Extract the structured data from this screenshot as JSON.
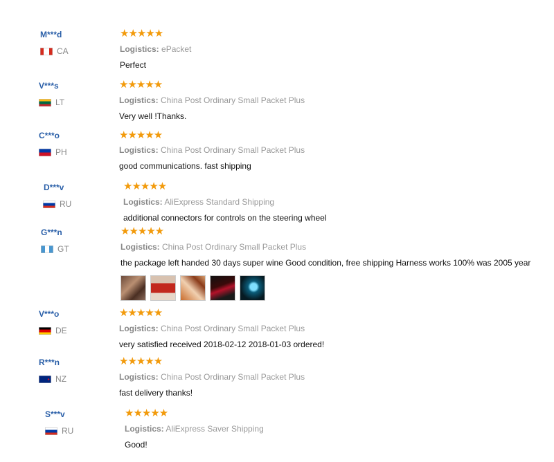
{
  "reviews": [
    {
      "user": "M***d",
      "country": "CA",
      "logistics_label": "Logistics:",
      "logistics": "ePacket",
      "feedback": "Perfect",
      "rating": 5
    },
    {
      "user": "V***s",
      "country": "LT",
      "logistics_label": "Logistics:",
      "logistics": "China Post Ordinary Small Packet Plus",
      "feedback": "Very well !Thanks.",
      "rating": 5
    },
    {
      "user": "C***o",
      "country": "PH",
      "logistics_label": "Logistics:",
      "logistics": "China Post Ordinary Small Packet Plus",
      "feedback": "good communications. fast shipping",
      "rating": 5
    },
    {
      "user": "D***v",
      "country": "RU",
      "logistics_label": "Logistics:",
      "logistics": "AliExpress Standard Shipping",
      "feedback": "additional connectors for controls on the steering wheel",
      "rating": 5
    },
    {
      "user": "G***n",
      "country": "GT",
      "logistics_label": "Logistics:",
      "logistics": "China Post Ordinary Small Packet Plus",
      "feedback": "the package left handed 30 days super wine Good condition, free shipping Harness works 100% was 2005 year",
      "rating": 5,
      "photo_count": 5
    },
    {
      "user": "V***o",
      "country": "DE",
      "logistics_label": "Logistics:",
      "logistics": "China Post Ordinary Small Packet Plus",
      "feedback": "very satisfied received 2018-02-12 2018-01-03 ordered!",
      "rating": 5
    },
    {
      "user": "R***n",
      "country": "NZ",
      "logistics_label": "Logistics:",
      "logistics": "China Post Ordinary Small Packet Plus",
      "feedback": "fast delivery thanks!",
      "rating": 5
    },
    {
      "user": "S***v",
      "country": "RU",
      "logistics_label": "Logistics:",
      "logistics": "AliExpress Saver Shipping",
      "feedback": "Good!",
      "rating": 5
    }
  ],
  "star_glyph": "★★★★★",
  "colors": {
    "star": "#f29a0b",
    "username": "#2a5fa8",
    "muted": "#999999"
  }
}
